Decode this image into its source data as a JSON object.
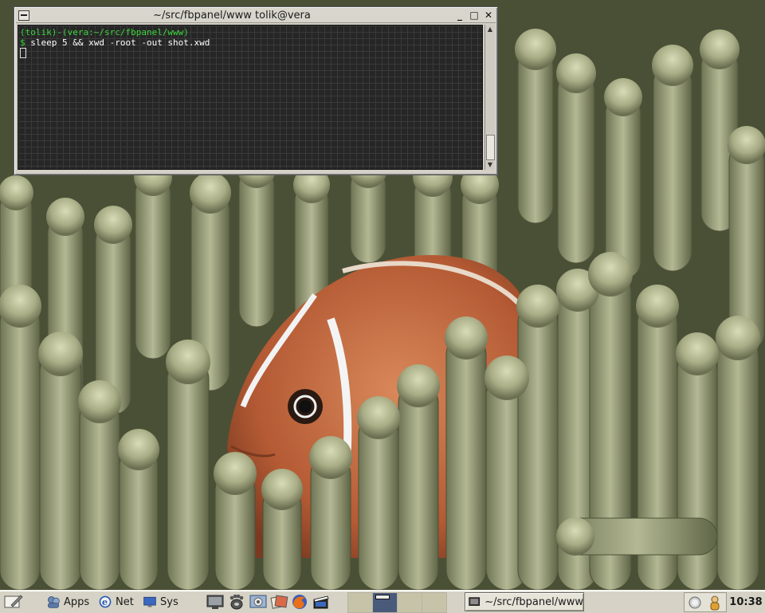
{
  "terminal": {
    "title": "~/src/fbpanel/www tolik@vera",
    "prompt_user": "(tolik)",
    "prompt_host_path": "(vera:~/src/fbpanel/www)",
    "prompt_symbol": "$",
    "command": "sleep 5 && xwd -root -out shot.xwd",
    "buttons": {
      "minimize": "_",
      "maximize": "□",
      "close": "✕"
    }
  },
  "panel": {
    "menus": [
      {
        "label": "Apps",
        "icon": "apps-icon"
      },
      {
        "label": "Net",
        "icon": "browser-e-icon"
      },
      {
        "label": "Sys",
        "icon": "monitor-icon"
      }
    ],
    "launchers": [
      "show-desktop-icon",
      "gnome-foot-icon",
      "file-manager-icon",
      "image-viewer-icon",
      "firefox-icon",
      "media-player-icon"
    ],
    "pager": {
      "desktops": 4,
      "active": 2
    },
    "task": {
      "label": "~/src/fbpanel/www",
      "icon": "terminal-icon"
    },
    "tray_icons": [
      "network-icon",
      "user-icon"
    ],
    "clock": "10:38"
  },
  "colors": {
    "panel_bg": "#d6d3c6",
    "terminal_bg": "#262626",
    "prompt_green": "#3ad63a",
    "pager_active": "#4a5a7a"
  }
}
